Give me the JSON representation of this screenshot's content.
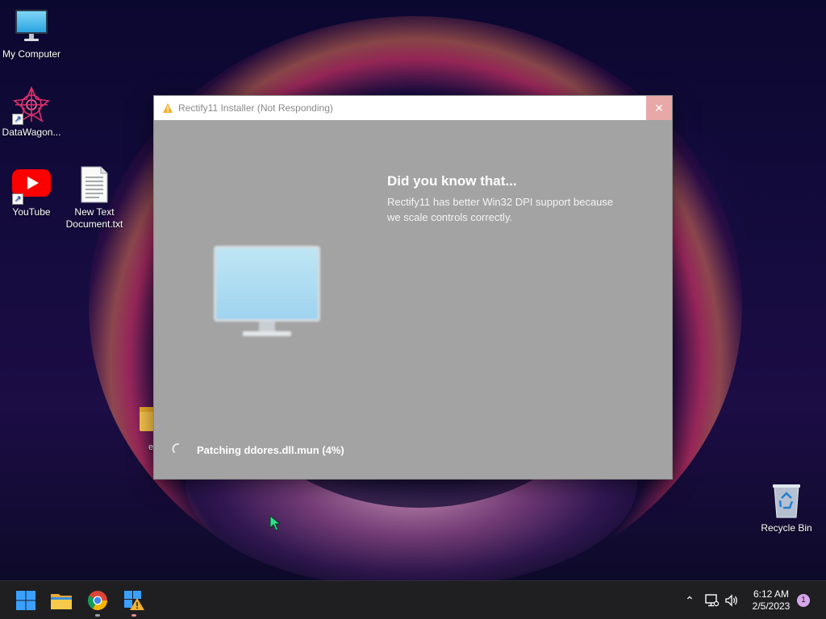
{
  "desktop": {
    "icons": [
      {
        "label": "My Computer",
        "icon": "monitor-icon"
      },
      {
        "label": "DataWagon...",
        "icon": "datawagon-logo-icon"
      },
      {
        "label": "YouTube",
        "icon": "youtube-icon"
      },
      {
        "label": "New Text Document.txt",
        "icon": "text-document-icon"
      },
      {
        "label": "Recycle Bin",
        "icon": "recycle-bin-icon"
      },
      {
        "label": "e",
        "icon": "folder-icon"
      }
    ]
  },
  "window": {
    "title": "Rectify11 Installer (Not Responding)",
    "close_glyph": "✕",
    "heading": "Did you know that...",
    "body": "Rectify11 has better Win32 DPI support because we scale controls correctly.",
    "status": "Patching ddores.dll.mun (4%)",
    "progress_percent": 4
  },
  "taskbar": {
    "apps": [
      {
        "name": "Start",
        "icon": "windows-start-icon"
      },
      {
        "name": "File Explorer",
        "icon": "file-explorer-icon"
      },
      {
        "name": "Google Chrome",
        "icon": "chrome-icon"
      },
      {
        "name": "Rectify11 Installer",
        "icon": "installer-icon"
      }
    ],
    "tray": {
      "chevron_glyph": "⌃",
      "network_icon": "network-icon",
      "volume_icon": "volume-icon"
    },
    "clock": {
      "time": "6:12 AM",
      "date": "2/5/2023"
    },
    "notification_count": "1"
  },
  "colors": {
    "window_body": "#a3a3a3",
    "close_button": "#e8a8a8",
    "taskbar": "#1f1f22",
    "accent_blue": "#0a84ff"
  }
}
